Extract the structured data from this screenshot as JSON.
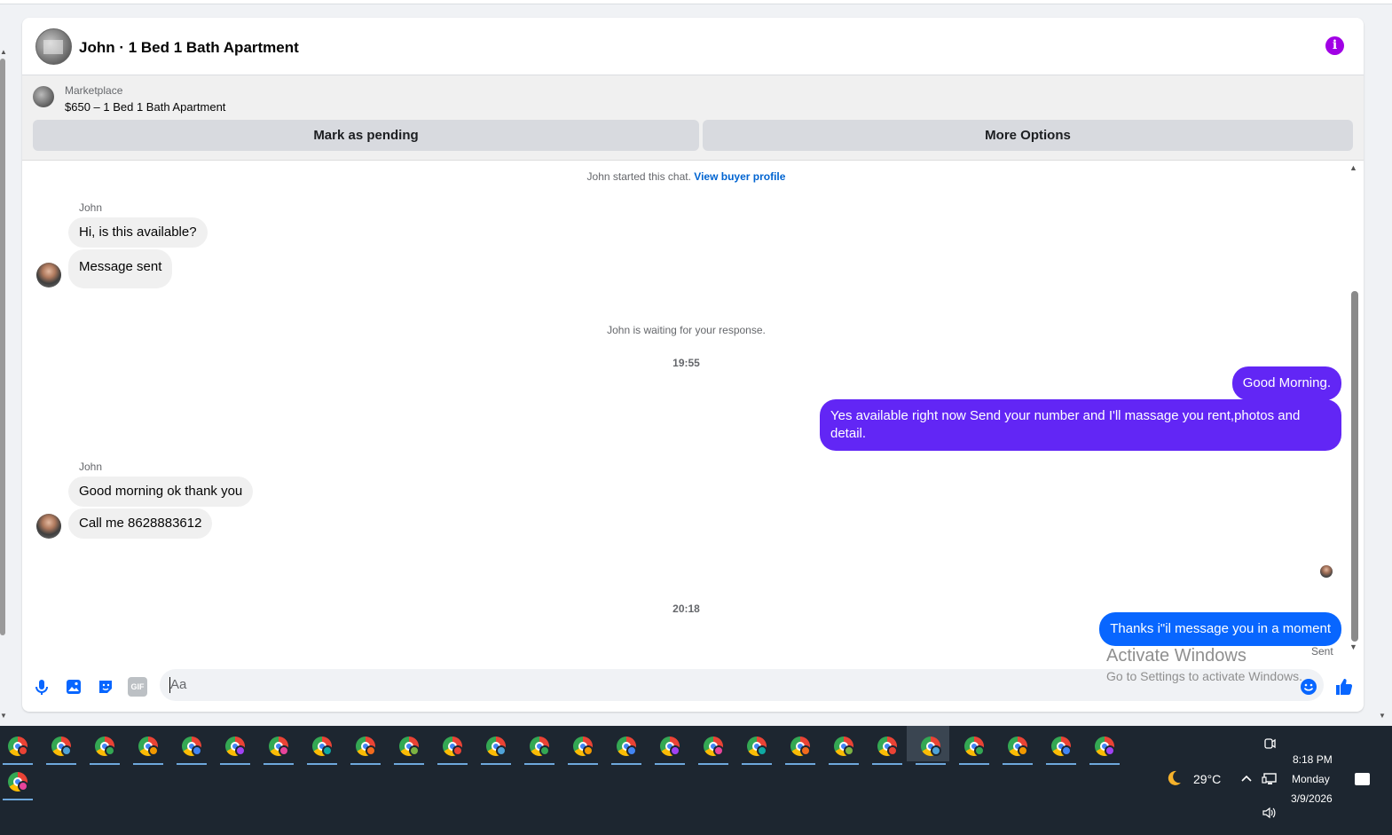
{
  "header": {
    "title": "John · 1 Bed 1 Bath Apartment",
    "info_icon": "i"
  },
  "listing": {
    "source": "Marketplace",
    "name": "$650 – 1 Bed 1 Bath Apartment",
    "pending_button": "Mark as pending",
    "more_button": "More Options"
  },
  "conversation": {
    "started_text": "John started this chat.",
    "buyer_profile_link": "View buyer profile",
    "group1": {
      "sender": "John",
      "messages": [
        "Hi, is this available?",
        "Message sent"
      ]
    },
    "waiting_text": "John is waiting for your response.",
    "time1": "19:55",
    "outgoing1": [
      "Good Morning.",
      "Yes available right now Send your number and I'll massage you rent,photos and detail."
    ],
    "group2": {
      "sender": "John",
      "messages": [
        "Good morning ok thank you",
        "Call me 8628883612"
      ]
    },
    "time2": "20:18",
    "outgoing2": [
      "Thanks i\"il message you in a moment"
    ],
    "status": "Sent"
  },
  "composer": {
    "placeholder": "Aa",
    "icons": [
      "microphone-icon",
      "photo-icon",
      "sticker-icon",
      "gif-icon",
      "emoji-icon",
      "thumbs-up-icon"
    ],
    "gif_label": "GIF"
  },
  "watermark": {
    "title": "Activate Windows",
    "subtitle": "Go to Settings to activate Windows."
  },
  "taskbar": {
    "weather_temp": "29°C",
    "time": "8:18 PM",
    "day": "Monday",
    "date": "3/9/2026",
    "app_count": 27
  },
  "colors": {
    "outgoing_purple": "#6226f5",
    "outgoing_blue": "#0866ff",
    "info_purple": "#a100e5",
    "link_blue": "#0064d1"
  }
}
